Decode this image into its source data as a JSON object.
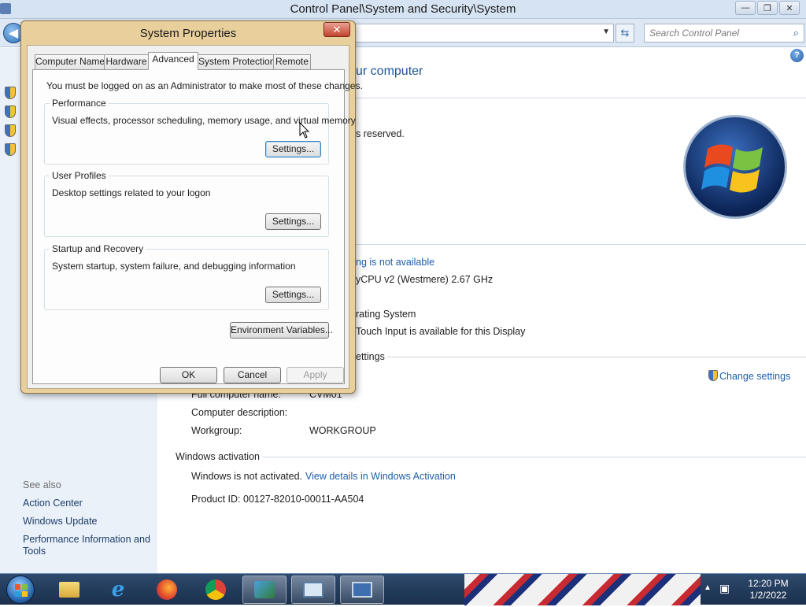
{
  "window": {
    "title": "Control Panel\\System and Security\\System",
    "minimize_glyph": "—",
    "maximize_glyph": "❐",
    "close_glyph": "✕"
  },
  "addressbar": {
    "search_placeholder": "Search Control Panel"
  },
  "left_pane": {
    "see_also": "See also",
    "links": [
      "Action Center",
      "Windows Update",
      "Performance Information and",
      "Tools"
    ]
  },
  "main": {
    "heading_partial": "ur computer",
    "copyright_partial": "s reserved.",
    "rating_partial": "ng is not available",
    "processor_partial": "yCPU v2 (Westmere)   2.67 GHz",
    "system_type_partial": "rating System",
    "pen_touch_partial": "Touch Input is available for this Display",
    "section_settings_partial": "ettings",
    "change_settings": "Change settings",
    "full_computer_name_label": "Full computer name:",
    "full_computer_name_value": "CVM01",
    "computer_description_label": "Computer description:",
    "workgroup_label": "Workgroup:",
    "workgroup_value": "WORKGROUP",
    "activation_section": "Windows activation",
    "activation_status": "Windows is not activated.",
    "activation_link": "View details in Windows Activation",
    "product_id": "Product ID: 00127-82010-00011-AA504"
  },
  "dialog": {
    "title": "System Properties",
    "close_glyph": "✕",
    "tabs": [
      "Computer Name",
      "Hardware",
      "Advanced",
      "System Protection",
      "Remote"
    ],
    "active_tab": "Advanced",
    "admin_note": "You must be logged on as an Administrator to make most of these changes.",
    "groups": [
      {
        "title": "Performance",
        "desc": "Visual effects, processor scheduling, memory usage, and virtual memory",
        "button": "Settings..."
      },
      {
        "title": "User Profiles",
        "desc": "Desktop settings related to your logon",
        "button": "Settings..."
      },
      {
        "title": "Startup and Recovery",
        "desc": "System startup, system failure, and debugging information",
        "button": "Settings..."
      }
    ],
    "env_button": "Environment Variables...",
    "ok": "OK",
    "cancel": "Cancel",
    "apply": "Apply"
  },
  "taskbar": {
    "time": "12:20 PM",
    "date": "1/2/2022"
  },
  "colors": {
    "dialog_frame": "#e8cf9c",
    "link": "#1c5fa8",
    "taskbar": "#1a2f4c"
  }
}
